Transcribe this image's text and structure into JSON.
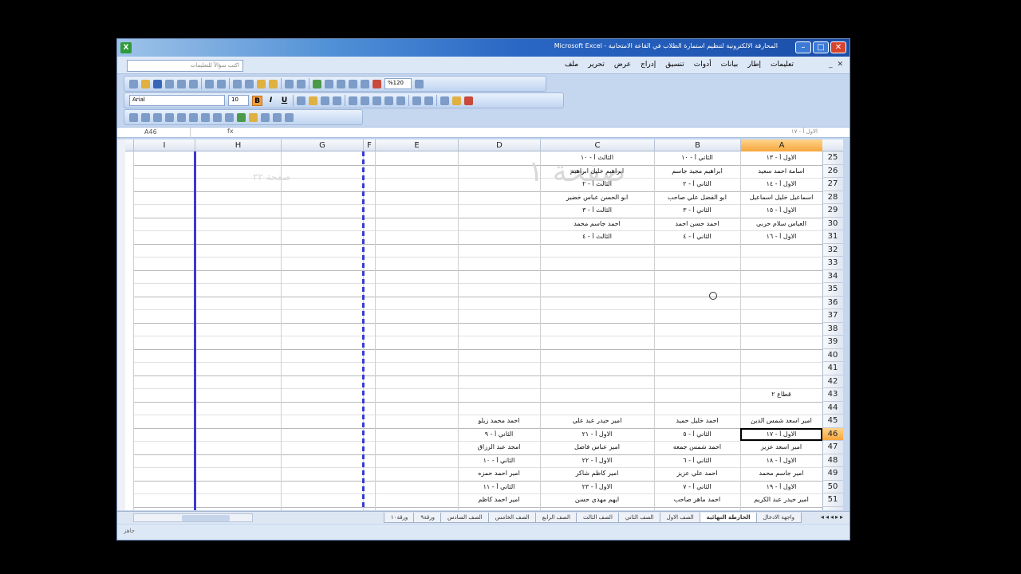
{
  "window": {
    "title": "المحارقة الالكترونية لتنظيم استمارة الطلاب في القاعة الامتحانية - Microsoft Excel",
    "app_icon": "excel-icon"
  },
  "menu": {
    "help_placeholder": "اكتب سؤالاً للتعليمات",
    "items": [
      "ملف",
      "تحرير",
      "عرض",
      "إدراج",
      "تنسيق",
      "أدوات",
      "بيانات",
      "إطار",
      "تعليمات"
    ]
  },
  "toolbar": {
    "font": "Arial",
    "size": "10",
    "zoom": "%120",
    "bold": "B",
    "italic": "I",
    "underline": "U"
  },
  "formula": {
    "namebox": "A46",
    "fx": "fx",
    "content": "الاول أ - ١٧"
  },
  "columns": [
    "A",
    "B",
    "C",
    "D",
    "E",
    "F",
    "G",
    "H",
    "I"
  ],
  "selected_column": "A",
  "rows": [
    "25",
    "26",
    "27",
    "28",
    "29",
    "30",
    "31",
    "32",
    "33",
    "34",
    "35",
    "36",
    "37",
    "38",
    "39",
    "40",
    "41",
    "42",
    "43",
    "44",
    "45",
    "46",
    "47",
    "48",
    "49",
    "50",
    "51"
  ],
  "selected_row": "46",
  "cells": [
    {
      "col": "A",
      "row": "25",
      "text": "الاول أ - ١٣"
    },
    {
      "col": "B",
      "row": "25",
      "text": "الثاني أ - ١٠"
    },
    {
      "col": "C",
      "row": "25",
      "text": "الثالث أ - ١٠"
    },
    {
      "col": "A",
      "row": "26",
      "text": "اسامة احمد سعيد"
    },
    {
      "col": "B",
      "row": "26",
      "text": "ابراهيم مجيد جاسم"
    },
    {
      "col": "C",
      "row": "26",
      "text": "ابراهيم خليل ابراهيم"
    },
    {
      "col": "A",
      "row": "27",
      "text": "الاول أ - ١٤"
    },
    {
      "col": "B",
      "row": "27",
      "text": "الثاني أ - ٢"
    },
    {
      "col": "C",
      "row": "27",
      "text": "الثالث أ - ٢"
    },
    {
      "col": "A",
      "row": "28",
      "text": "اسماعيل خليل اسماعيل"
    },
    {
      "col": "B",
      "row": "28",
      "text": "ابو الفضل علي صاحب"
    },
    {
      "col": "C",
      "row": "28",
      "text": "ابو الحسن عباس خضير"
    },
    {
      "col": "A",
      "row": "29",
      "text": "الاول أ - ١٥"
    },
    {
      "col": "B",
      "row": "29",
      "text": "الثاني أ - ٣"
    },
    {
      "col": "C",
      "row": "29",
      "text": "الثالث أ - ٣"
    },
    {
      "col": "A",
      "row": "30",
      "text": "العباس سلام حربي"
    },
    {
      "col": "B",
      "row": "30",
      "text": "احمد حسن احمد"
    },
    {
      "col": "C",
      "row": "30",
      "text": "احمد جاسم محمد"
    },
    {
      "col": "A",
      "row": "31",
      "text": "الاول أ - ١٦"
    },
    {
      "col": "B",
      "row": "31",
      "text": "الثاني أ - ٤"
    },
    {
      "col": "C",
      "row": "31",
      "text": "الثالث أ - ٤"
    },
    {
      "col": "A",
      "row": "43",
      "text": "قطاع ٢"
    },
    {
      "col": "A",
      "row": "45",
      "text": "امير اسعد شمس الدين"
    },
    {
      "col": "B",
      "row": "45",
      "text": "احمد خليل حميد"
    },
    {
      "col": "C",
      "row": "45",
      "text": "امير حيدر عبد علي"
    },
    {
      "col": "D",
      "row": "45",
      "text": "احمد محمد زيلو"
    },
    {
      "col": "A",
      "row": "46",
      "text": "الاول أ - ١٧"
    },
    {
      "col": "B",
      "row": "46",
      "text": "الثاني أ - ٥"
    },
    {
      "col": "C",
      "row": "46",
      "text": "الاول أ - ٢١"
    },
    {
      "col": "D",
      "row": "46",
      "text": "الثاني أ - ٩"
    },
    {
      "col": "A",
      "row": "47",
      "text": "امير اسعد عزيز"
    },
    {
      "col": "B",
      "row": "47",
      "text": "احمد شمس جمعه"
    },
    {
      "col": "C",
      "row": "47",
      "text": "امير عباس فاضل"
    },
    {
      "col": "D",
      "row": "47",
      "text": "امجد عبد الرزاق"
    },
    {
      "col": "A",
      "row": "48",
      "text": "الاول أ - ١٨"
    },
    {
      "col": "B",
      "row": "48",
      "text": "الثاني أ - ٦"
    },
    {
      "col": "C",
      "row": "48",
      "text": "الاول أ - ٢٢"
    },
    {
      "col": "D",
      "row": "48",
      "text": "الثاني أ - ١٠"
    },
    {
      "col": "A",
      "row": "49",
      "text": "امير جاسم محمد"
    },
    {
      "col": "B",
      "row": "49",
      "text": "احمد علي عزيز"
    },
    {
      "col": "C",
      "row": "49",
      "text": "امير كاظم شاكر"
    },
    {
      "col": "D",
      "row": "49",
      "text": "امير احمد حمزه"
    },
    {
      "col": "A",
      "row": "50",
      "text": "الاول أ - ١٩"
    },
    {
      "col": "B",
      "row": "50",
      "text": "الثاني أ - ٧"
    },
    {
      "col": "C",
      "row": "50",
      "text": "الاول أ - ٢٣"
    },
    {
      "col": "D",
      "row": "50",
      "text": "الثاني أ - ١١"
    },
    {
      "col": "A",
      "row": "51",
      "text": "امير حيدر عبد الكريم"
    },
    {
      "col": "B",
      "row": "51",
      "text": "احمد ماهر صاحب"
    },
    {
      "col": "C",
      "row": "51",
      "text": "ايهم مهدي حسن"
    },
    {
      "col": "D",
      "row": "51",
      "text": "امير احمد كاظم"
    }
  ],
  "watermarks": {
    "page1": "صفحة ١",
    "page22": "صفحة ٢٢"
  },
  "sheet_tabs": [
    "واجهة الادخال",
    "الخارطة النهائية",
    "الصف الاول",
    "الصف الثاني",
    "الصف الثالث",
    "الصف الرابع",
    "الصف الخامس",
    "الصف السادس",
    "ورقة٩",
    "ورقة١٠"
  ],
  "active_tab": "الخارطة النهائية",
  "status": "جاهز"
}
